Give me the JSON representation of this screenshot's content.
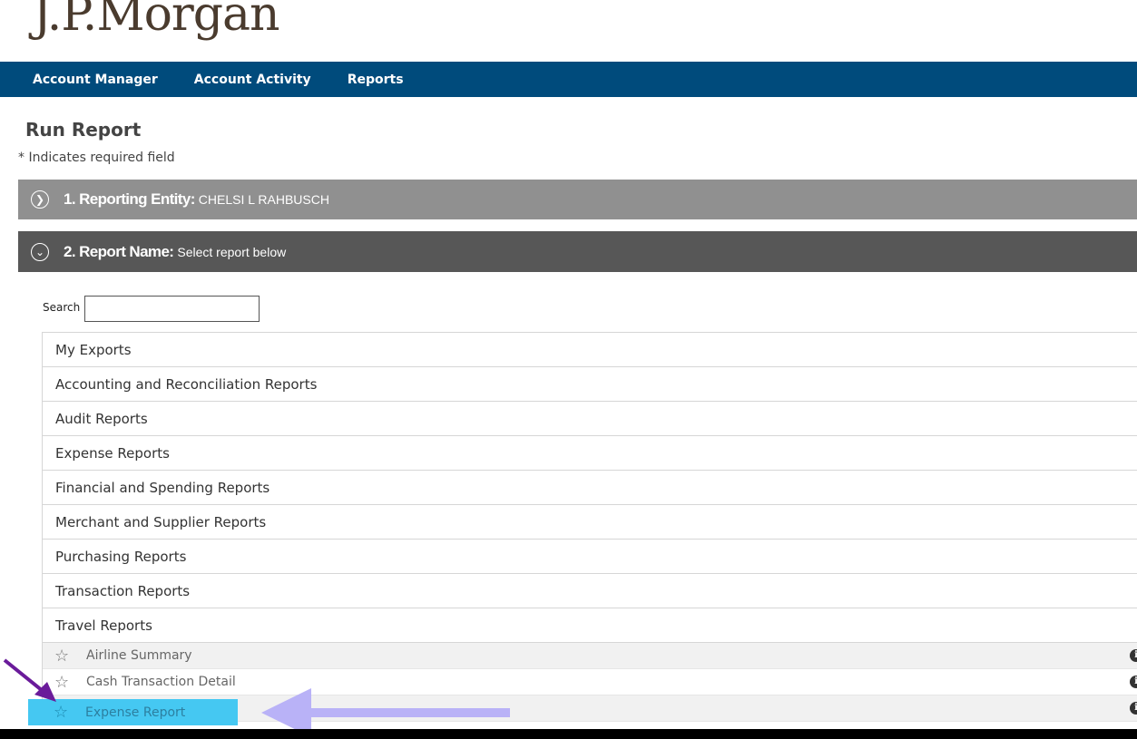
{
  "brand": {
    "logo": "J.P.Morgan"
  },
  "nav": [
    {
      "label": "Account Manager"
    },
    {
      "label": "Account Activity"
    },
    {
      "label": "Reports"
    }
  ],
  "page": {
    "title": "Run Report",
    "required_note": "* Indicates required field"
  },
  "sections": [
    {
      "icon": "chevron-right-circle-icon",
      "title": "1. Reporting Entity:",
      "value": "CHELSI L RAHBUSCH"
    },
    {
      "icon": "chevron-down-circle-icon",
      "title": "2. Report Name:",
      "value": "Select report below"
    }
  ],
  "search": {
    "label": "Search",
    "value": ""
  },
  "categories": [
    "My Exports",
    "Accounting and Reconciliation Reports",
    "Audit Reports",
    "Expense Reports",
    "Financial and Spending Reports",
    "Merchant and Supplier Reports",
    "Purchasing Reports",
    "Transaction Reports",
    "Travel Reports"
  ],
  "travel_reports": [
    {
      "name": "Airline Summary",
      "icon": "star-outline-icon",
      "info_icon": "info-icon"
    },
    {
      "name": "Cash Transaction Detail",
      "icon": "star-outline-icon",
      "info_icon": "info-icon"
    },
    {
      "name": "Expense Report",
      "icon": "star-outline-icon",
      "info_icon": "info-icon",
      "highlighted": true
    }
  ],
  "colors": {
    "nav": "#004b7c",
    "section1": "#909090",
    "section2": "#575757",
    "highlight": "#45c8f2",
    "arrow_dark": "#6a1b9a",
    "arrow_light": "#b9b2f7"
  }
}
